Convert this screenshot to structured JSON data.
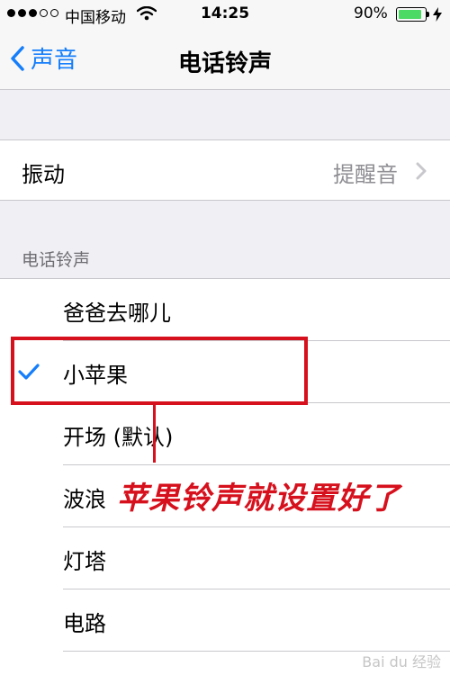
{
  "status_bar": {
    "carrier": "中国移动",
    "time": "14:25",
    "battery_percent": "90%",
    "battery_level": 0.9,
    "signal_bars": 3,
    "signal_total": 5
  },
  "nav": {
    "back_label": "声音",
    "title": "电话铃声"
  },
  "vibration": {
    "label": "振动",
    "value": "提醒音"
  },
  "ringtones": {
    "header": "电话铃声",
    "items": [
      {
        "label": "爸爸去哪儿",
        "selected": false
      },
      {
        "label": "小苹果",
        "selected": true
      },
      {
        "label": "开场 (默认)",
        "selected": false
      },
      {
        "label": "波浪",
        "selected": false
      },
      {
        "label": "灯塔",
        "selected": false
      },
      {
        "label": "电路",
        "selected": false
      }
    ]
  },
  "annotation": {
    "text": "苹果铃声就设置好了"
  },
  "watermark": "Bai du 经验",
  "colors": {
    "accent": "#157efb",
    "annotation": "#d6101c",
    "battery": "#4cd964"
  }
}
